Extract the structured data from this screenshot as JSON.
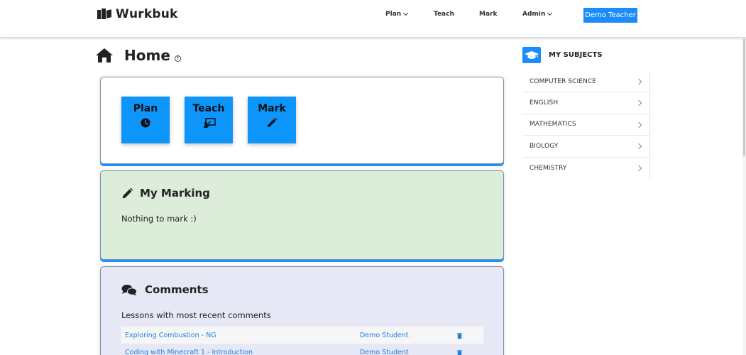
{
  "navbar": {
    "brand": "Wurkbuk",
    "menu": [
      {
        "label": "Plan",
        "dropdown": true
      },
      {
        "label": "Teach",
        "dropdown": false
      },
      {
        "label": "Mark",
        "dropdown": false
      },
      {
        "label": "Admin",
        "dropdown": true
      }
    ],
    "user_button": "Demo Teacher"
  },
  "page": {
    "title": "Home",
    "help_glyph": "?"
  },
  "actions": [
    {
      "label": "Plan",
      "icon": "clock-icon"
    },
    {
      "label": "Teach",
      "icon": "presentation-icon"
    },
    {
      "label": "Mark",
      "icon": "pencil-icon"
    }
  ],
  "marking": {
    "title": "My Marking",
    "message": "Nothing to mark :)"
  },
  "comments": {
    "title": "Comments",
    "subtitle": "Lessons with most recent comments",
    "rows": [
      {
        "lesson": "Exploring Combustion - NG",
        "student": "Demo Student"
      },
      {
        "lesson": "Coding with Minecraft 1 - Introduction",
        "student": "Demo Student"
      }
    ]
  },
  "subjects": {
    "title": "MY SUBJECTS",
    "items": [
      "COMPUTER SCIENCE",
      "ENGLISH",
      "MATHEMATICS",
      "BIOLOGY",
      "CHEMISTRY"
    ]
  },
  "colors": {
    "accent": "#1d8cf8",
    "action_button": "#0d95fa",
    "marking_bg": "#dcedd9",
    "comments_bg": "#e7e8f6",
    "link": "#1d7fe0"
  }
}
